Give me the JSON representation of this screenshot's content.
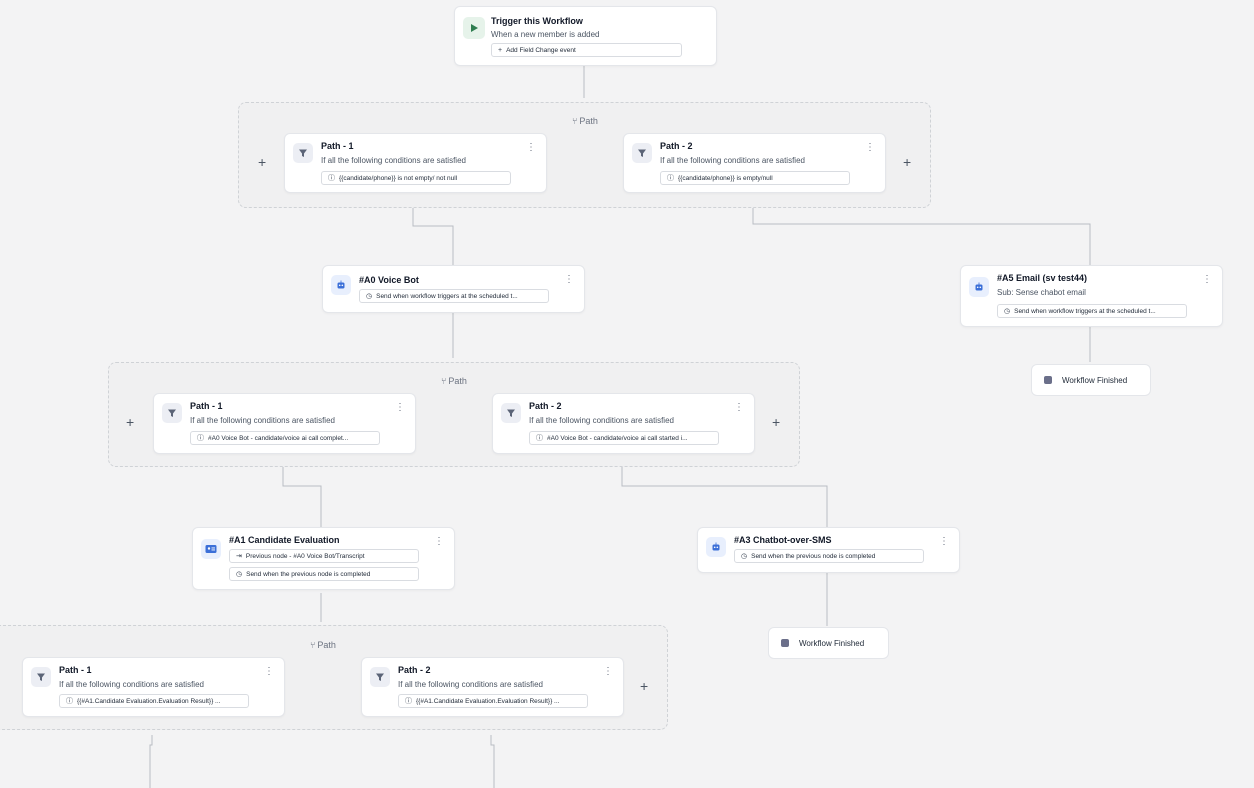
{
  "trigger": {
    "title": "Trigger this Workflow",
    "subtitle": "When a new member is added",
    "add_field_label": "Add Field Change event"
  },
  "group1": {
    "label": "Path",
    "path1": {
      "title": "Path - 1",
      "sub": "If all the following conditions are satisfied",
      "chip": "{{candidate/phone}} is not empty/ not null"
    },
    "path2": {
      "title": "Path - 2",
      "sub": "If all the following conditions are satisfied",
      "chip": "{{candidate/phone}} is empty/null"
    }
  },
  "voicebot": {
    "title": "#A0 Voice Bot",
    "chip": "Send when workflow triggers at the scheduled t..."
  },
  "email": {
    "title": "#A5 Email (sv test44)",
    "sub": "Sub: Sense chabot email",
    "chip": "Send when workflow triggers at the scheduled t..."
  },
  "finished1": {
    "label": "Workflow Finished"
  },
  "group2": {
    "label": "Path",
    "path1": {
      "title": "Path - 1",
      "sub": "If all the following conditions are satisfied",
      "chip": "#A0 Voice Bot - candidate/voice ai call complet..."
    },
    "path2": {
      "title": "Path - 2",
      "sub": "If all the following conditions are satisfied",
      "chip": "#A0 Voice Bot - candidate/voice ai call started i..."
    }
  },
  "evaluation": {
    "title": "#A1 Candidate Evaluation",
    "chip1": "Previous node - #A0 Voice Bot/Transcript",
    "chip2": "Send when the previous node is completed"
  },
  "chatbot": {
    "title": "#A3 Chatbot-over-SMS",
    "chip": "Send when the previous node is completed"
  },
  "finished2": {
    "label": "Workflow Finished"
  },
  "group3": {
    "label": "Path",
    "path1": {
      "title": "Path - 1",
      "sub": "If all the following conditions are satisfied",
      "chip": "{{#A1.Candidate Evaluation.Evaluation Result}} ..."
    },
    "path2": {
      "title": "Path - 2",
      "sub": "If all the following conditions are satisfied",
      "chip": "{{#A1.Candidate Evaluation.Evaluation Result}} ..."
    }
  },
  "icons": {
    "play": "play-icon",
    "filter": "filter-icon",
    "bot": "bot-icon",
    "evaluation": "id-card-icon",
    "clock": "clock-icon",
    "info": "info-icon",
    "branch": "branch-icon",
    "plus": "plus-icon",
    "kebab": "kebab-icon"
  },
  "colors": {
    "background": "#f3f3f4",
    "play_green": "#2e7d4f",
    "bot_blue": "#3b6fd8",
    "filter_slate": "#5b6477",
    "finished_square": "#6b6f8a"
  }
}
